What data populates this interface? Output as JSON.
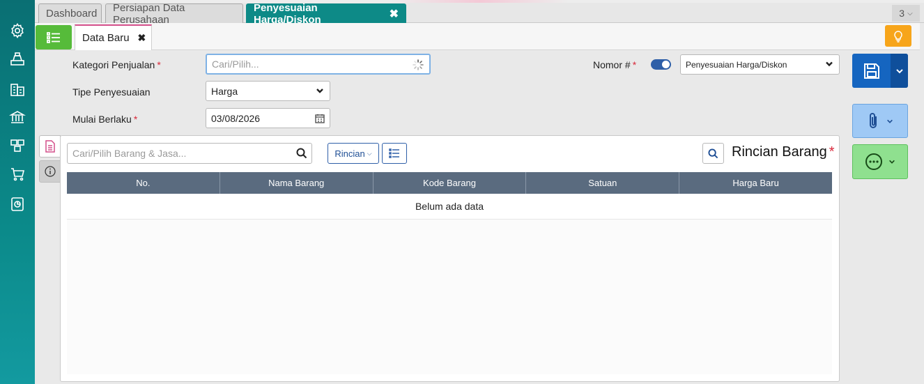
{
  "sidebar": {
    "icons": [
      "gear-icon",
      "cashier-icon",
      "building-icon",
      "bank-icon",
      "inventory-icon",
      "cart-icon",
      "report-icon"
    ]
  },
  "tabs": [
    {
      "label": "Dashboard"
    },
    {
      "label": "Persiapan Data Perusahaan"
    },
    {
      "label": "Penyesuaian Harga/Diskon"
    }
  ],
  "tab_count": "3",
  "subheader": {
    "tab_label": "Data Baru"
  },
  "form": {
    "kategori_label": "Kategori Penjualan",
    "kategori_placeholder": "Cari/Pilih...",
    "tipe_label": "Tipe Penyesuaian",
    "tipe_value": "Harga",
    "mulai_label": "Mulai Berlaku",
    "mulai_value": "03/08/2026",
    "nomor_label": "Nomor #",
    "nomor_value": "Penyesuaian Harga/Diskon",
    "required_mark": "*"
  },
  "panel": {
    "search_placeholder": "Cari/Pilih Barang & Jasa...",
    "rincian_label": "Rincian",
    "title": "Rincian Barang",
    "columns": [
      "No.",
      "Nama Barang",
      "Kode Barang",
      "Satuan",
      "Harga Baru"
    ],
    "empty_text": "Belum ada data"
  },
  "colors": {
    "sidebar": "#0b8a8a",
    "active_tab": "#0d8a87",
    "save": "#1565c0",
    "attach": "#9fc9f5",
    "more": "#8fe08f",
    "list_button": "#56bb3a",
    "bulb": "#f7a51a",
    "grid_header": "#5a6b7f"
  }
}
